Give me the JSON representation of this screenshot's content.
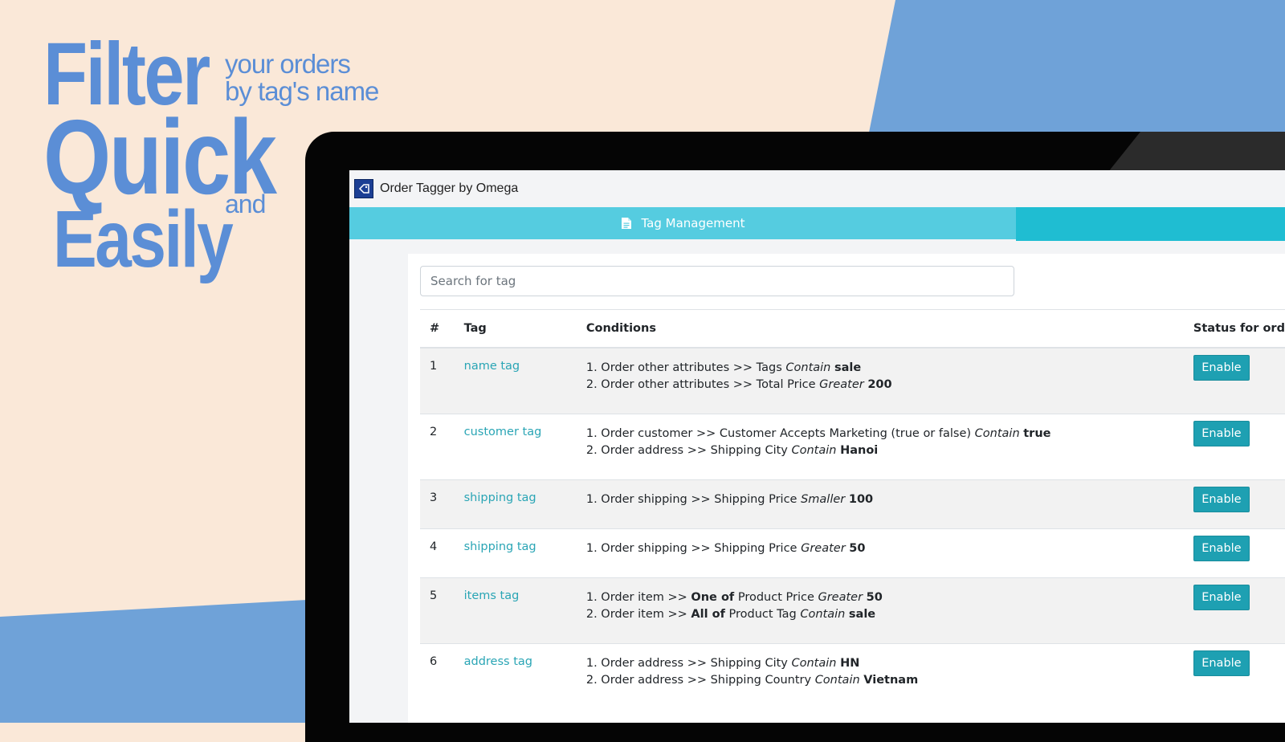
{
  "hero": {
    "word_filter": "Filter",
    "tagline_line1": "your orders",
    "tagline_line2": "by tag's name",
    "word_quick": "Quick",
    "word_and": "and",
    "word_easily": "Easily"
  },
  "app": {
    "title": "Order Tagger by Omega",
    "tab_label": "Tag Management",
    "search_placeholder": "Search for tag"
  },
  "table": {
    "headers": {
      "num": "#",
      "tag": "Tag",
      "conditions": "Conditions",
      "status": "Status for ord"
    },
    "rows": [
      {
        "num": "1",
        "tag": "name tag",
        "button": "Enable",
        "conditions": [
          {
            "prefix": "1. Order other attributes >> Tags ",
            "op": "Contain",
            "value": "sale"
          },
          {
            "prefix": "2. Order other attributes >> Total Price ",
            "op": "Greater",
            "value": "200"
          }
        ]
      },
      {
        "num": "2",
        "tag": "customer tag",
        "button": "Enable",
        "conditions": [
          {
            "prefix": "1. Order customer >> Customer Accepts Marketing (true or false) ",
            "op": "Contain",
            "value": "true"
          },
          {
            "prefix": "2. Order address >> Shipping City ",
            "op": "Contain",
            "value": "Hanoi"
          }
        ]
      },
      {
        "num": "3",
        "tag": "shipping tag",
        "button": "Enable",
        "conditions": [
          {
            "prefix": "1. Order shipping >> Shipping Price ",
            "op": "Smaller",
            "value": "100"
          }
        ]
      },
      {
        "num": "4",
        "tag": "shipping tag",
        "button": "Enable",
        "conditions": [
          {
            "prefix": "1. Order shipping >> Shipping Price ",
            "op": "Greater",
            "value": "50"
          }
        ]
      },
      {
        "num": "5",
        "tag": "items tag",
        "button": "Enable",
        "conditions": [
          {
            "prefix": "1. Order item >> ",
            "bold_mid": "One of",
            "mid": " Product Price ",
            "op": "Greater",
            "value": "50"
          },
          {
            "prefix": "2. Order item >> ",
            "bold_mid": "All of",
            "mid": " Product Tag ",
            "op": "Contain",
            "value": "sale"
          }
        ]
      },
      {
        "num": "6",
        "tag": "address tag",
        "button": "Enable",
        "conditions": [
          {
            "prefix": "1. Order address >> Shipping City ",
            "op": "Contain",
            "value": "HN"
          },
          {
            "prefix": "2. Order address >> Shipping Country ",
            "op": "Contain",
            "value": "Vietnam"
          }
        ]
      }
    ]
  },
  "colors": {
    "background_peach": "#fae8d8",
    "accent_blue": "#6fa2d8",
    "headline_blue": "#5b8ed6",
    "tab_active": "#55cce0",
    "tab_bar": "#1fbdd2",
    "button": "#1ea0b2",
    "link": "#2aa5b5"
  },
  "icons": {
    "app_logo": "tag-logo-icon",
    "tab": "document-icon"
  }
}
